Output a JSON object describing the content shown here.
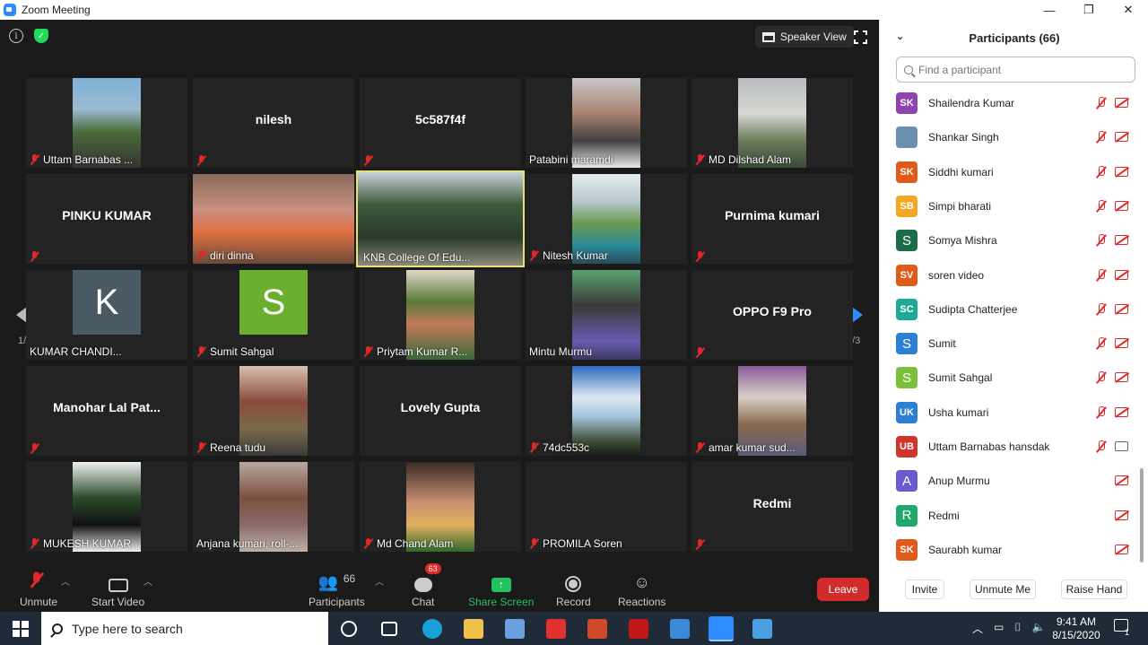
{
  "window": {
    "title": "Zoom Meeting",
    "min": "—",
    "restore": "❐",
    "close": "✕"
  },
  "meeting": {
    "speaker_view": "Speaker View",
    "page_left": "1/3",
    "page_right": "1/3",
    "tiles": [
      {
        "name": "Uttam Barnabas ...",
        "kind": "video"
      },
      {
        "name": "nilesh",
        "kind": "name"
      },
      {
        "name": "5c587f4f",
        "kind": "name"
      },
      {
        "name": "Patabini maramdi",
        "kind": "video"
      },
      {
        "name": "MD Dilshad Alam",
        "kind": "video"
      },
      {
        "name": "PINKU KUMAR",
        "kind": "name"
      },
      {
        "name": "diri dinna",
        "kind": "video"
      },
      {
        "name": "KNB College Of Edu...",
        "kind": "video"
      },
      {
        "name": "Nitesh Kumar",
        "kind": "video"
      },
      {
        "name": "Purnima kumari",
        "kind": "name"
      },
      {
        "name": "KUMAR CHANDI...",
        "kind": "avatar",
        "letter": "K"
      },
      {
        "name": "Sumit Sahgal",
        "kind": "avatar",
        "letter": "S"
      },
      {
        "name": "Priytam Kumar R...",
        "kind": "video"
      },
      {
        "name": "Mintu Murmu",
        "kind": "video"
      },
      {
        "name": "OPPO F9 Pro",
        "kind": "name"
      },
      {
        "name": "Manohar Lal Pat...",
        "kind": "name"
      },
      {
        "name": "Reena tudu",
        "kind": "video"
      },
      {
        "name": "Lovely Gupta",
        "kind": "name"
      },
      {
        "name": "74dc553c",
        "kind": "video"
      },
      {
        "name": "amar kumar sud...",
        "kind": "video"
      },
      {
        "name": "MUKESH KUMAR",
        "kind": "video"
      },
      {
        "name": "Anjana kumari, roll-...",
        "kind": "video"
      },
      {
        "name": "Md Chand Alam",
        "kind": "video"
      },
      {
        "name": "PROMILA Soren",
        "kind": "empty"
      },
      {
        "name": "Redmi",
        "kind": "name"
      }
    ]
  },
  "toolbar": {
    "unmute": "Unmute",
    "start_video": "Start Video",
    "participants": "Participants",
    "participants_count": "66",
    "chat": "Chat",
    "chat_badge": "63",
    "share_screen": "Share Screen",
    "record": "Record",
    "reactions": "Reactions",
    "leave": "Leave"
  },
  "panel": {
    "title": "Participants (66)",
    "search_placeholder": "Find a participant",
    "participants": [
      {
        "initials": "SK",
        "name": "Shailendra Kumar",
        "color": "#8e44ad",
        "cam": "off"
      },
      {
        "initials": "",
        "name": "Shankar Singh",
        "color": "#6a8fb0",
        "cam": "off",
        "photo": true
      },
      {
        "initials": "SK",
        "name": "Siddhi kumari",
        "color": "#e05a1a",
        "cam": "off"
      },
      {
        "initials": "SB",
        "name": "Simpi bharati",
        "color": "#f5a623",
        "cam": "off"
      },
      {
        "initials": "S",
        "name": "Somya Mishra",
        "color": "#1e6b4a",
        "cam": "off"
      },
      {
        "initials": "SV",
        "name": "soren video",
        "color": "#e05a1a",
        "cam": "off"
      },
      {
        "initials": "SC",
        "name": "Sudipta Chatterjee",
        "color": "#1fa89a",
        "cam": "off"
      },
      {
        "initials": "S",
        "name": "Sumit",
        "color": "#2d7fd3",
        "cam": "off"
      },
      {
        "initials": "S",
        "name": "Sumit Sahgal",
        "color": "#7cbf3a",
        "cam": "off"
      },
      {
        "initials": "UK",
        "name": "Usha kumari",
        "color": "#2d7fd3",
        "cam": "off"
      },
      {
        "initials": "UB",
        "name": "Uttam Barnabas hansdak",
        "color": "#d0352b",
        "cam": "on"
      },
      {
        "initials": "A",
        "name": "Anup Murmu",
        "color": "#6a5ad0",
        "cam": "off",
        "nomic": true
      },
      {
        "initials": "R",
        "name": "Redmi",
        "color": "#1fa86a",
        "cam": "off",
        "nomic": true
      },
      {
        "initials": "SK",
        "name": "Saurabh kumar",
        "color": "#e05a1a",
        "cam": "off",
        "nomic": true
      }
    ],
    "invite": "Invite",
    "unmute_me": "Unmute Me",
    "raise_hand": "Raise Hand"
  },
  "taskbar": {
    "search_placeholder": "Type here to search",
    "time": "9:41 AM",
    "date": "8/15/2020",
    "notif_count": "1"
  }
}
